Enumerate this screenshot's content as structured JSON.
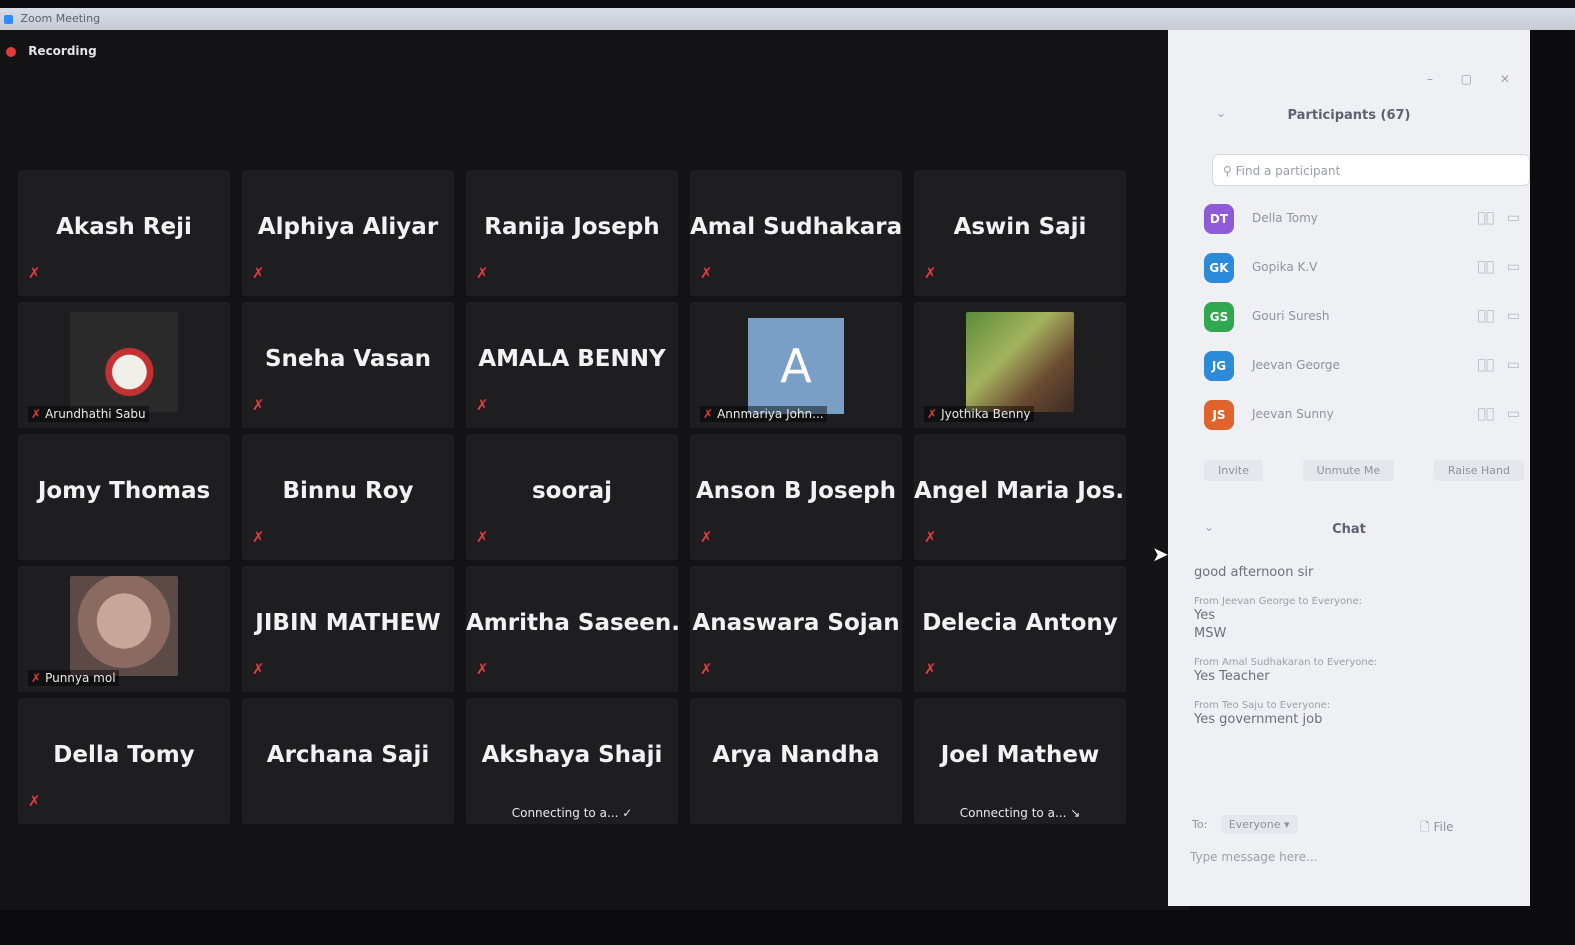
{
  "window": {
    "title": "Zoom Meeting"
  },
  "recording": {
    "label": "Recording"
  },
  "tiles": [
    {
      "name": "Akash Reji",
      "muted": true
    },
    {
      "name": "Alphiya Aliyar",
      "muted": true
    },
    {
      "name": "Ranija Joseph",
      "muted": true
    },
    {
      "name": "Amal Sudhakaran",
      "muted": true
    },
    {
      "name": "Aswin Saji",
      "muted": true
    },
    {
      "name": "",
      "sublabel": "Arundhathi Sabu",
      "photo": "ph1",
      "muted": true
    },
    {
      "name": "Sneha Vasan",
      "muted": true
    },
    {
      "name": "AMALA BENNY",
      "muted": true
    },
    {
      "name": "",
      "sublabel": "Annmariya John...",
      "avatar_letter": "A",
      "muted": true
    },
    {
      "name": "",
      "sublabel": "Jyothika Benny",
      "photo": "ph2",
      "muted": true
    },
    {
      "name": "Jomy Thomas",
      "muted": false
    },
    {
      "name": "Binnu Roy",
      "muted": true
    },
    {
      "name": "sooraj",
      "muted": true
    },
    {
      "name": "Anson B Joseph",
      "muted": true
    },
    {
      "name": "Angel Maria Jos...",
      "muted": true
    },
    {
      "name": "",
      "sublabel": "Punnya mol",
      "photo": "ph3",
      "muted": true
    },
    {
      "name": "JIBIN MATHEW",
      "muted": true
    },
    {
      "name": "Amritha Saseen...",
      "muted": true
    },
    {
      "name": "Anaswara Sojan",
      "muted": true
    },
    {
      "name": "Delecia Antony",
      "muted": true
    },
    {
      "name": "Della Tomy",
      "muted": true
    },
    {
      "name": "Archana Saji",
      "muted": false
    },
    {
      "name": "Akshaya Shaji",
      "muted": false,
      "connecting": "Connecting to a... ✓"
    },
    {
      "name": "Arya Nandha",
      "muted": false
    },
    {
      "name": "Joel Mathew",
      "muted": false,
      "connecting": "Connecting to a... ↘"
    }
  ],
  "participants": {
    "title": "Participants (67)",
    "search_placeholder": "Find a participant",
    "items": [
      {
        "initials": "DT",
        "name": "Della Tomy",
        "color": "#8e5ad8"
      },
      {
        "initials": "GK",
        "name": "Gopika K.V",
        "color": "#2b8bd8"
      },
      {
        "initials": "GS",
        "name": "Gouri Suresh",
        "color": "#2fa84f"
      },
      {
        "initials": "JG",
        "name": "Jeevan George",
        "color": "#2b8bd8"
      },
      {
        "initials": "JS",
        "name": "Jeevan Sunny",
        "color": "#e0632b"
      }
    ],
    "buttons": [
      "Invite",
      "Unmute Me",
      "Raise Hand"
    ]
  },
  "chat": {
    "title": "Chat",
    "messages": [
      {
        "from": "",
        "text": "good afternoon sir"
      },
      {
        "from": "From Jeevan George to Everyone:",
        "text": "Yes\nMSW"
      },
      {
        "from": "From Amal Sudhakaran to Everyone:",
        "text": "Yes Teacher"
      },
      {
        "from": "From Teo Saju to Everyone:",
        "text": "Yes government job"
      }
    ],
    "to_label": "To:",
    "to_value": "Everyone ▾",
    "file_label": "File",
    "input_placeholder": "Type message here..."
  },
  "colors": {
    "mute": "#e03c3c",
    "stage": "#141416",
    "tile": "#1e1e20",
    "panel": "#eef0f4"
  }
}
